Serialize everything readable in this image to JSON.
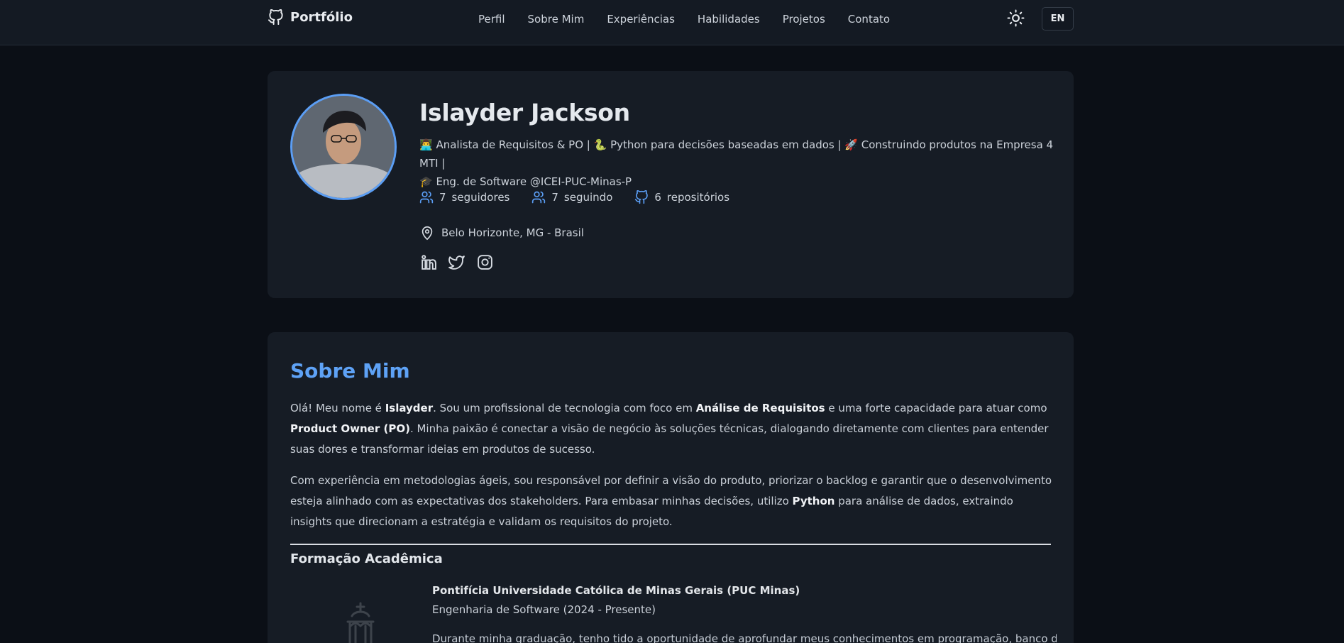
{
  "colors": {
    "accent": "#5b9ef5",
    "background": "#0b0f16",
    "card": "#161c25"
  },
  "nav": {
    "brand": "Portfólio",
    "links": [
      "Perfil",
      "Sobre Mim",
      "Experiências",
      "Habilidades",
      "Projetos",
      "Contato"
    ],
    "language": "EN"
  },
  "profile": {
    "name": "Islayder Jackson",
    "bio_line1": "👨‍💻 Analista de Requisitos & PO | 🐍 Python para decisões baseadas em dados | 🚀 Construindo produtos na Empresa 4 MTI |",
    "bio_line2": "🎓 Eng. de Software @ICEI-PUC-Minas-P",
    "stats": [
      {
        "count": "7",
        "label": "seguidores",
        "icon": "users-icon"
      },
      {
        "count": "7",
        "label": "seguindo",
        "icon": "users-icon"
      },
      {
        "count": "6",
        "label": "repositórios",
        "icon": "github-icon"
      }
    ],
    "location": "Belo Horizonte, MG - Brasil",
    "socials": [
      "linkedin-icon",
      "twitter-icon",
      "instagram-icon"
    ]
  },
  "about": {
    "title": "Sobre Mim",
    "p1_a": "Olá! Meu nome é ",
    "p1_name": "Islayder",
    "p1_b": ". Sou um profissional de tecnologia com foco em ",
    "p1_role": "Análise de Requisitos",
    "p1_c": " e uma forte capacidade para atuar como ",
    "p1_po": "Product Owner (PO)",
    "p1_d": ". Minha paixão é conectar a visão de negócio às soluções técnicas, dialogando diretamente com clientes para entender suas dores e transformar ideias em produtos de sucesso.",
    "p2_a": "Com experiência em metodologias ágeis, sou responsável por definir a visão do produto, priorizar o backlog e garantir que o desenvolvimento esteja alinhado com as expectativas dos stakeholders. Para embasar minhas decisões, utilizo ",
    "p2_python": "Python",
    "p2_b": " para análise de dados, extraindo insights que direcionam a estratégia e validam os requisitos do projeto.",
    "education_title": "Formação Acadêmica",
    "university": "Pontifícia Universidade Católica de Minas Gerais (PUC Minas)",
    "degree": "Engenharia de Software (2024 - Presente)",
    "description": "Durante minha graduação, tenho tido a oportunidade de aprofundar meus conhecimentos em programação, banco de dados"
  }
}
